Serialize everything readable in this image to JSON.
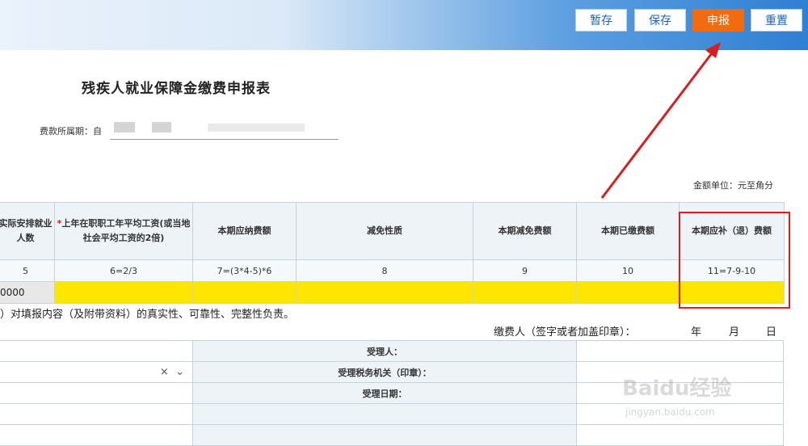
{
  "toolbar": {
    "buttons": [
      {
        "label": "暂存"
      },
      {
        "label": "保存"
      },
      {
        "label": "申报"
      },
      {
        "label": "重置"
      }
    ]
  },
  "form": {
    "title": "残疾人就业保障金缴费申报表",
    "period_label": "费款所属期：自",
    "unit_label": "金额单位：元至角分"
  },
  "table": {
    "headers": [
      "实际安排就业人数",
      "上年在职职工年平均工资(或当地社会平均工资的2倍)",
      "本期应纳费额",
      "减免性质",
      "本期减免费额",
      "本期已缴费额",
      "本期应补（退）费额"
    ],
    "required_mark": "*",
    "formulas": [
      "5",
      "6=2/3",
      "7=(3*4-5)*6",
      "8",
      "9",
      "10",
      "11=7-9-10"
    ],
    "first_value": "0000"
  },
  "declaration": {
    "text": "）对填报内容（及附带资料）的真实性、可靠性、完整性负责。",
    "signer_label": "缴费人（签字或者加盖印章）：",
    "year": "年",
    "month": "月",
    "day": "日"
  },
  "bottom": {
    "select_clear": "×",
    "select_chevron": "⌄",
    "receiver_label": "受理人：",
    "tax_office_label": "受理税务机关（印章）：",
    "receive_date_label": "受理日期："
  },
  "watermark": {
    "brand": "Baidu经验",
    "url": "jingyan.baidu.com"
  },
  "colors": {
    "primary_button": "#f26b0f",
    "highlight": "#d81e1e",
    "yellow_fill": "#ffe600",
    "header_bg": "#eef3f8"
  }
}
